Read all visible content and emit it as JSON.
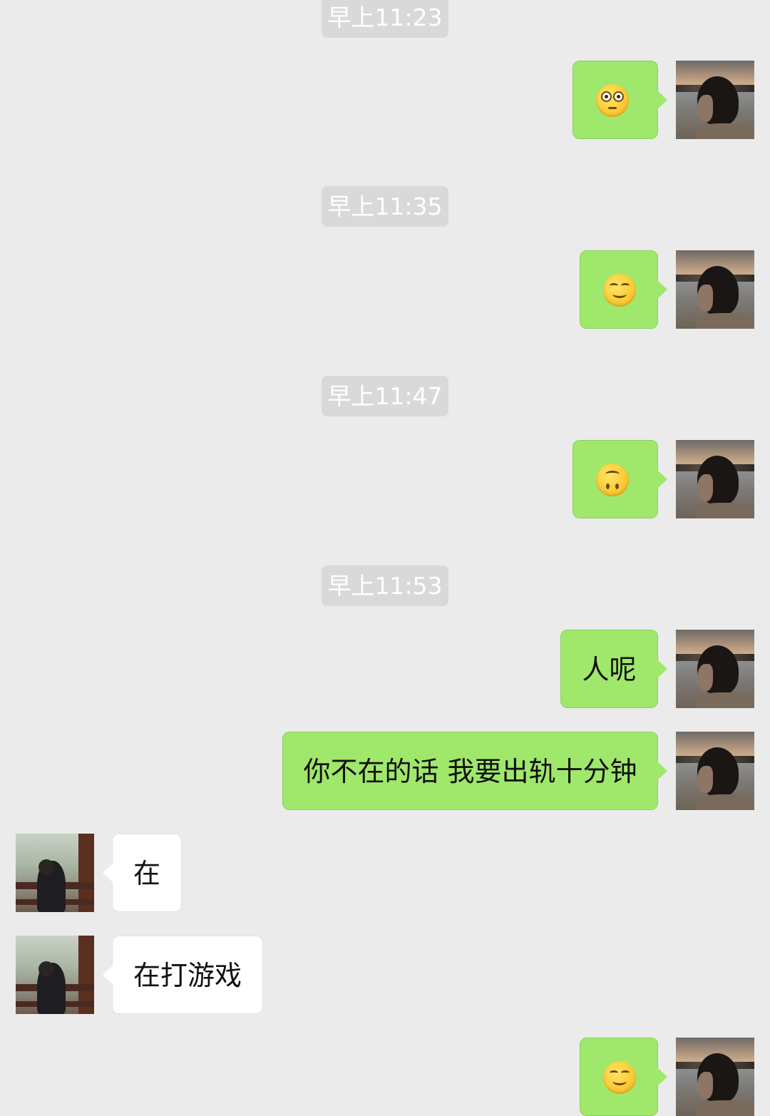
{
  "colors": {
    "background": "#ebebeb",
    "outgoing_bubble": "#9fe86b",
    "incoming_bubble": "#ffffff",
    "timestamp_pill": "#d9d9d9"
  },
  "messages": [
    {
      "type": "timestamp",
      "text": "早上11:23"
    },
    {
      "type": "outgoing",
      "emoji": "flushed-face"
    },
    {
      "type": "timestamp",
      "text": "早上11:35"
    },
    {
      "type": "outgoing",
      "emoji": "relieved-face"
    },
    {
      "type": "timestamp",
      "text": "早上11:47"
    },
    {
      "type": "outgoing",
      "emoji": "upside-down-face"
    },
    {
      "type": "timestamp",
      "text": "早上11:53"
    },
    {
      "type": "outgoing",
      "text": "人呢"
    },
    {
      "type": "outgoing",
      "text": "你不在的话 我要出轨十分钟"
    },
    {
      "type": "incoming",
      "text": "在"
    },
    {
      "type": "incoming",
      "text": "在打游戏"
    },
    {
      "type": "outgoing",
      "emoji": "relieved-face"
    }
  ]
}
